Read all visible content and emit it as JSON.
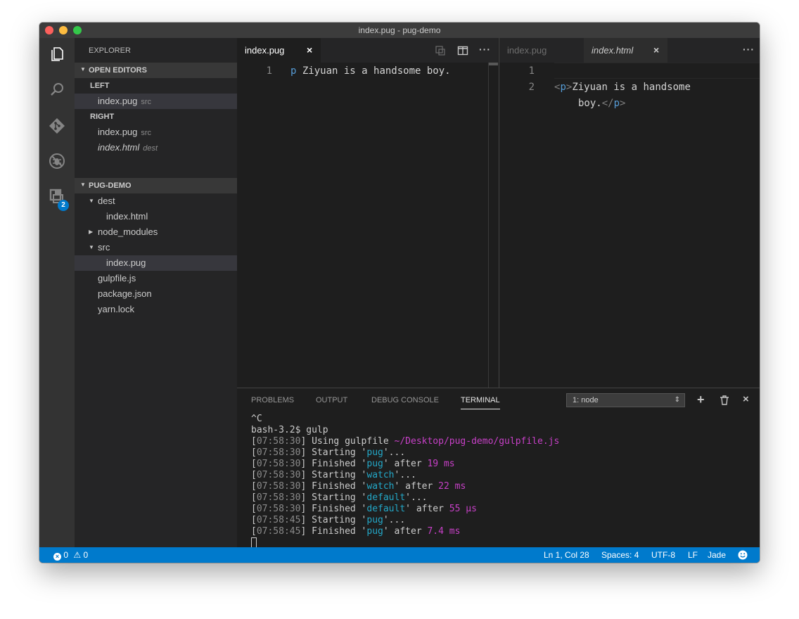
{
  "window": {
    "title": "index.pug - pug-demo"
  },
  "activity": {
    "badge": "2"
  },
  "sidebar": {
    "title": "EXPLORER",
    "open_editors": {
      "label": "OPEN EDITORS",
      "left_label": "LEFT",
      "left_items": [
        {
          "name": "index.pug",
          "desc": "src"
        }
      ],
      "right_label": "RIGHT",
      "right_items": [
        {
          "name": "index.pug",
          "desc": "src"
        },
        {
          "name": "index.html",
          "desc": "dest"
        }
      ]
    },
    "project": {
      "label": "PUG-DEMO",
      "tree": [
        "dest",
        "index.html",
        "node_modules",
        "src",
        "index.pug",
        "gulpfile.js",
        "package.json",
        "yarn.lock"
      ]
    }
  },
  "editor_left": {
    "tab": "index.pug",
    "close": "×",
    "line_numbers": [
      "1"
    ],
    "line1_tag": "p",
    "line1_text": " Ziyuan is a handsome boy."
  },
  "editor_right": {
    "tabs": [
      "index.pug",
      "index.html"
    ],
    "close": "×",
    "line_numbers": [
      "1",
      "2"
    ],
    "code": {
      "lt": "<",
      "tag": "p",
      "gt": ">",
      "text1": "Ziyuan is a handsome",
      "text2": "boy.",
      "close_lt": "</",
      "close_tag": "p",
      "close_gt": ">"
    }
  },
  "panel": {
    "tabs": [
      "PROBLEMS",
      "OUTPUT",
      "DEBUG CONSOLE",
      "TERMINAL"
    ],
    "terminal_select": "1: node",
    "select_arrow": "⇕",
    "terminal_lines": [
      [
        {
          "t": "^C"
        }
      ],
      [
        {
          "t": "bash-3.2$ gulp"
        }
      ],
      [
        {
          "t": "[",
          "c": ""
        },
        {
          "t": "07:58:30",
          "c": "gray"
        },
        {
          "t": "] Using gulpfile "
        },
        {
          "t": "~/Desktop/pug-demo/gulpfile.js",
          "c": "mag"
        }
      ],
      [
        {
          "t": "["
        },
        {
          "t": "07:58:30",
          "c": "gray"
        },
        {
          "t": "] Starting '"
        },
        {
          "t": "pug",
          "c": "cyn"
        },
        {
          "t": "'..."
        }
      ],
      [
        {
          "t": "["
        },
        {
          "t": "07:58:30",
          "c": "gray"
        },
        {
          "t": "] Finished '"
        },
        {
          "t": "pug",
          "c": "cyn"
        },
        {
          "t": "' after "
        },
        {
          "t": "19 ms",
          "c": "mag"
        }
      ],
      [
        {
          "t": "["
        },
        {
          "t": "07:58:30",
          "c": "gray"
        },
        {
          "t": "] Starting '"
        },
        {
          "t": "watch",
          "c": "cyn"
        },
        {
          "t": "'..."
        }
      ],
      [
        {
          "t": "["
        },
        {
          "t": "07:58:30",
          "c": "gray"
        },
        {
          "t": "] Finished '"
        },
        {
          "t": "watch",
          "c": "cyn"
        },
        {
          "t": "' after "
        },
        {
          "t": "22 ms",
          "c": "mag"
        }
      ],
      [
        {
          "t": "["
        },
        {
          "t": "07:58:30",
          "c": "gray"
        },
        {
          "t": "] Starting '"
        },
        {
          "t": "default",
          "c": "cyn"
        },
        {
          "t": "'..."
        }
      ],
      [
        {
          "t": "["
        },
        {
          "t": "07:58:30",
          "c": "gray"
        },
        {
          "t": "] Finished '"
        },
        {
          "t": "default",
          "c": "cyn"
        },
        {
          "t": "' after "
        },
        {
          "t": "55 μs",
          "c": "mag"
        }
      ],
      [
        {
          "t": "["
        },
        {
          "t": "07:58:45",
          "c": "gray"
        },
        {
          "t": "] Starting '"
        },
        {
          "t": "pug",
          "c": "cyn"
        },
        {
          "t": "'..."
        }
      ],
      [
        {
          "t": "["
        },
        {
          "t": "07:58:45",
          "c": "gray"
        },
        {
          "t": "] Finished '"
        },
        {
          "t": "pug",
          "c": "cyn"
        },
        {
          "t": "' after "
        },
        {
          "t": "7.4 ms",
          "c": "mag"
        }
      ]
    ]
  },
  "status": {
    "errors": "0",
    "warnings": "0",
    "position": "Ln 1, Col 28",
    "spaces": "Spaces: 4",
    "encoding": "UTF-8",
    "eol": "LF",
    "language": "Jade"
  }
}
